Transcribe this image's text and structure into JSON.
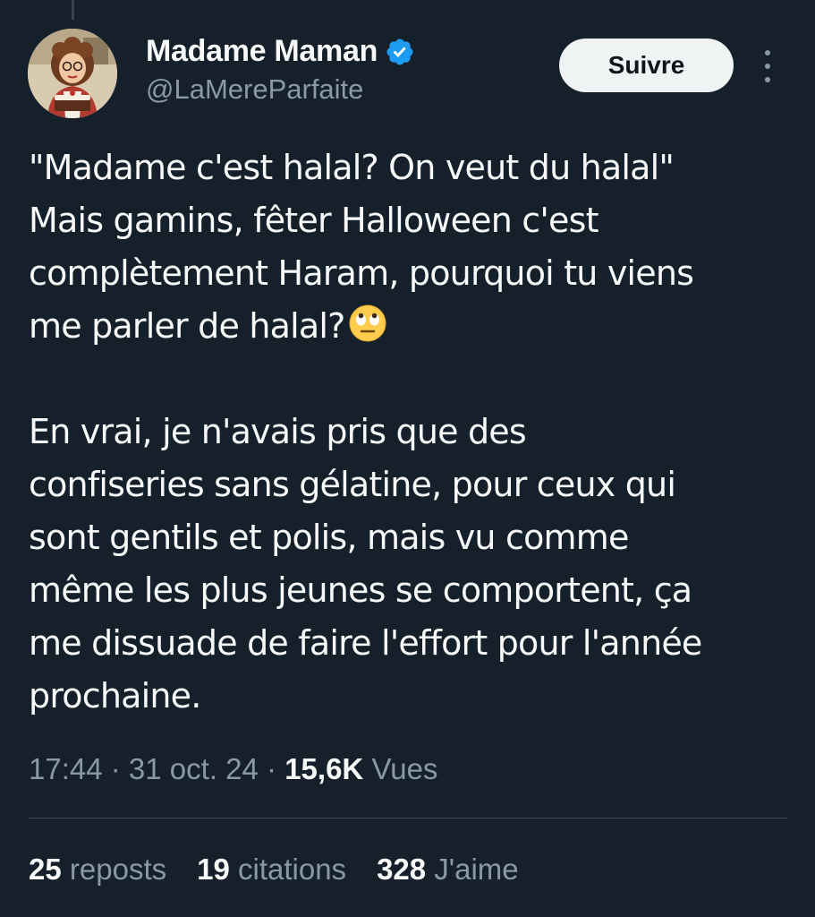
{
  "author": {
    "display_name": "Madame Maman",
    "handle": "@LaMereParfaite",
    "verified": true,
    "verified_color": "#1d9bf0"
  },
  "actions": {
    "follow_label": "Suivre",
    "more_icon": "more-vertical-icon"
  },
  "tweet": {
    "paragraph1": [
      "\"Madame c'est halal? On veut du halal\"",
      "Mais gamins, fêter Halloween c'est",
      "complètement Haram, pourquoi tu viens",
      "me parler de halal?"
    ],
    "emoji": "face-with-rolling-eyes",
    "paragraph2": [
      "En vrai, je n'avais pris que des",
      "confiseries sans gélatine, pour ceux qui",
      "sont gentils et polis, mais vu comme",
      "même les plus jeunes se comportent, ça",
      "me dissuade de faire l'effort pour l'année",
      "prochaine."
    ]
  },
  "meta": {
    "time": "17:44",
    "separator": " · ",
    "date": "31 oct. 24",
    "views_count": "15,6K",
    "views_label": "Vues"
  },
  "stats": {
    "reposts_count": "25",
    "reposts_label": "reposts",
    "quotes_count": "19",
    "quotes_label": "citations",
    "likes_count": "328",
    "likes_label": "J'aime"
  },
  "colors": {
    "background": "#15202b",
    "text_primary": "#f7f9f9",
    "text_secondary": "#8b98a5",
    "divider": "#38444d"
  }
}
